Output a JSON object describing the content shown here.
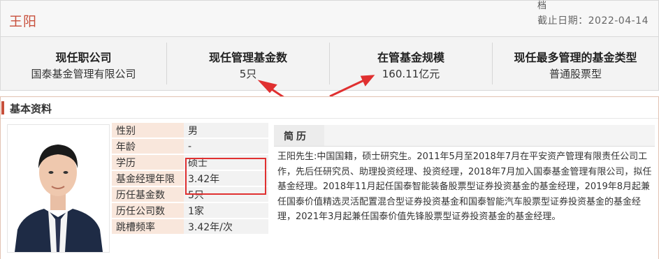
{
  "header": {
    "name": "王阳",
    "top_fragment": "档",
    "date_label": "截止日期：",
    "date_value": "2022-04-14"
  },
  "stats": [
    {
      "title": "现任职公司",
      "value": "国泰基金管理有限公司"
    },
    {
      "title": "现任管理基金数",
      "value": "5只"
    },
    {
      "title": "在管基金规模",
      "value": "160.11亿元"
    },
    {
      "title": "现任最多管理的基金类型",
      "value": "普通股票型"
    }
  ],
  "section": {
    "title": "基本资料"
  },
  "profile": [
    {
      "label": "性别",
      "value": "男"
    },
    {
      "label": "年龄",
      "value": "-"
    },
    {
      "label": "学历",
      "value": "硕士"
    },
    {
      "label": "基金经理年限",
      "value": "3.42年"
    },
    {
      "label": "历任基金数",
      "value": "5只"
    },
    {
      "label": "历任公司数",
      "value": "1家"
    },
    {
      "label": "跳槽频率",
      "value": "3.42年/次"
    }
  ],
  "bio": {
    "tab": "简历",
    "text": "王阳先生:中国国籍，硕士研究生。2011年5月至2018年7月在平安资产管理有限责任公司工作，先后任研究员、助理投资经理、投资经理，2018年7月加入国泰基金管理有限公司，拟任基金经理。2018年11月起任国泰智能装备股票型证券投资基金的基金经理，2019年8月起兼任国泰价值精选灵活配置混合型证券投资基金和国泰智能汽车股票型证券投资基金的基金经理，2021年3月起兼任国泰价值先锋股票型证券投资基金的基金经理。"
  },
  "colors": {
    "accent": "#c8503c",
    "highlight_box": "#e03030",
    "label_bg": "#f9e7dc",
    "arrow": "#e03030"
  }
}
